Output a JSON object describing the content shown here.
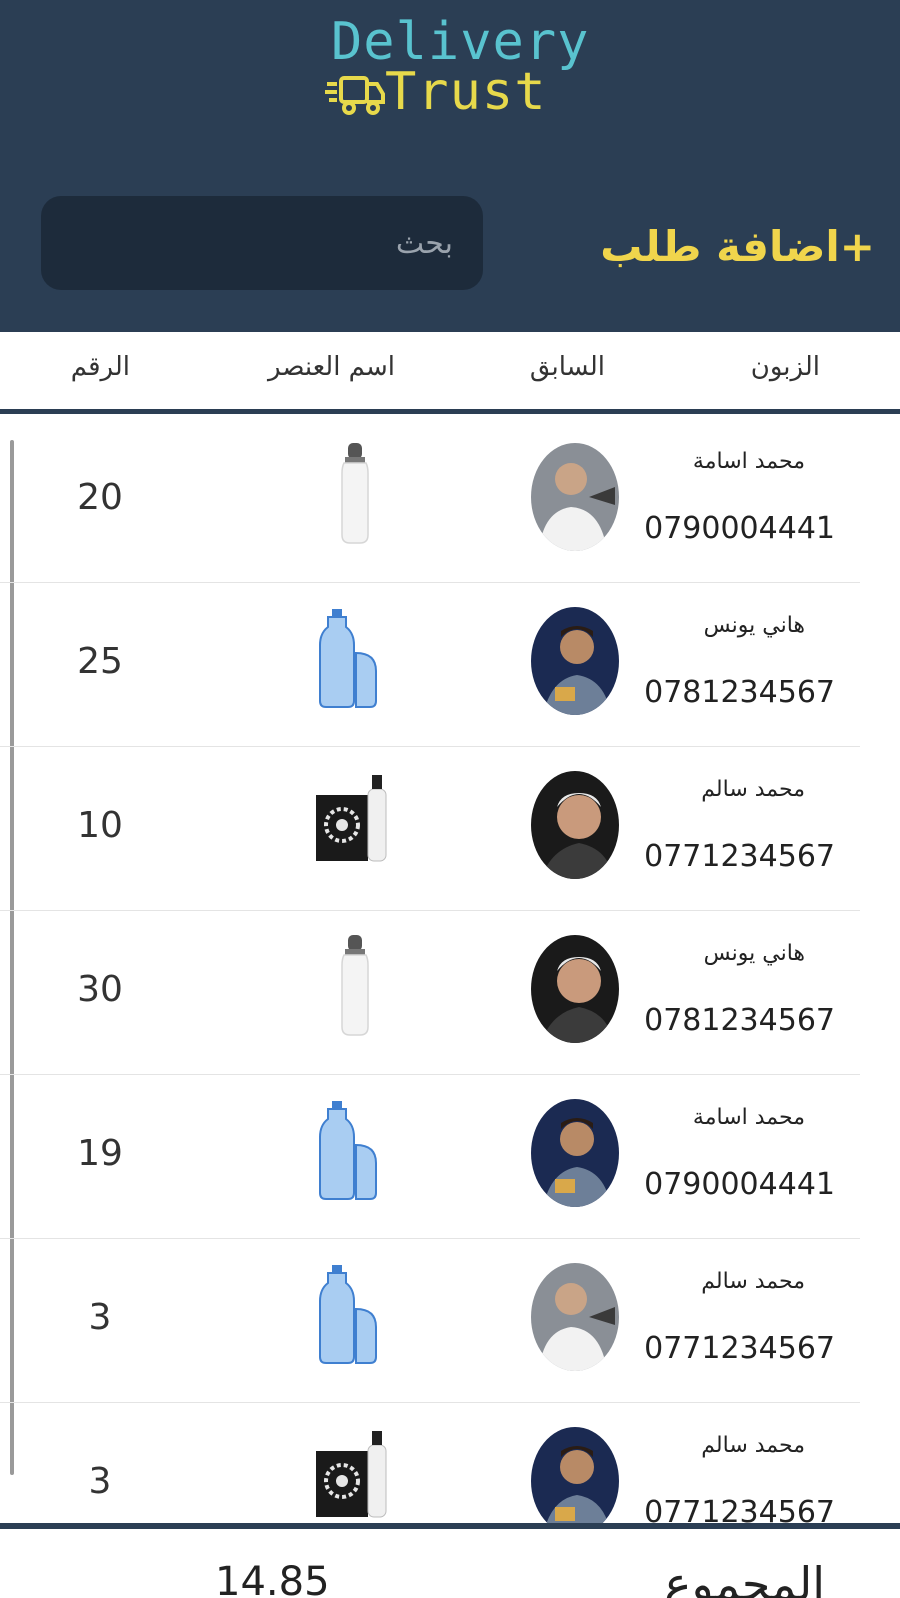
{
  "brand": {
    "line1": "Delivery",
    "line2": "Trust",
    "colors": {
      "line1": "#59c3cf",
      "line2": "#e7d94b",
      "header_bg": "#2b3e54",
      "accent": "#f0d54c"
    }
  },
  "header": {
    "add_order_label": "+اضافة طلب",
    "search_placeholder": "بحث"
  },
  "columns": {
    "customer": "الزبون",
    "driver": "السابق",
    "item_name": "اسم العنصر",
    "number": "الرقم"
  },
  "rows": [
    {
      "customer_name": "محمد اسامة",
      "phone": "0790004441",
      "driver_avatar": "avatar-driver-a",
      "item_icon": "bottle-icon",
      "number": "20"
    },
    {
      "customer_name": "هاني يونس",
      "phone": "0781234567",
      "driver_avatar": "avatar-driver-b",
      "item_icon": "water-gallon-icon",
      "number": "25"
    },
    {
      "customer_name": "محمد سالم",
      "phone": "0771234567",
      "driver_avatar": "avatar-driver-c",
      "item_icon": "product-box-icon",
      "number": "10"
    },
    {
      "customer_name": "هاني يونس",
      "phone": "0781234567",
      "driver_avatar": "avatar-driver-c",
      "item_icon": "bottle-icon",
      "number": "30"
    },
    {
      "customer_name": "محمد اسامة",
      "phone": "0790004441",
      "driver_avatar": "avatar-driver-b",
      "item_icon": "water-gallon-icon",
      "number": "19"
    },
    {
      "customer_name": "محمد سالم",
      "phone": "0771234567",
      "driver_avatar": "avatar-driver-a",
      "item_icon": "water-gallon-icon",
      "number": "3"
    },
    {
      "customer_name": "محمد سالم",
      "phone": "0771234567",
      "driver_avatar": "avatar-driver-b",
      "item_icon": "product-box-icon",
      "number": "3"
    }
  ],
  "footer": {
    "total_label": "المجموع",
    "total_value": "14.85"
  }
}
